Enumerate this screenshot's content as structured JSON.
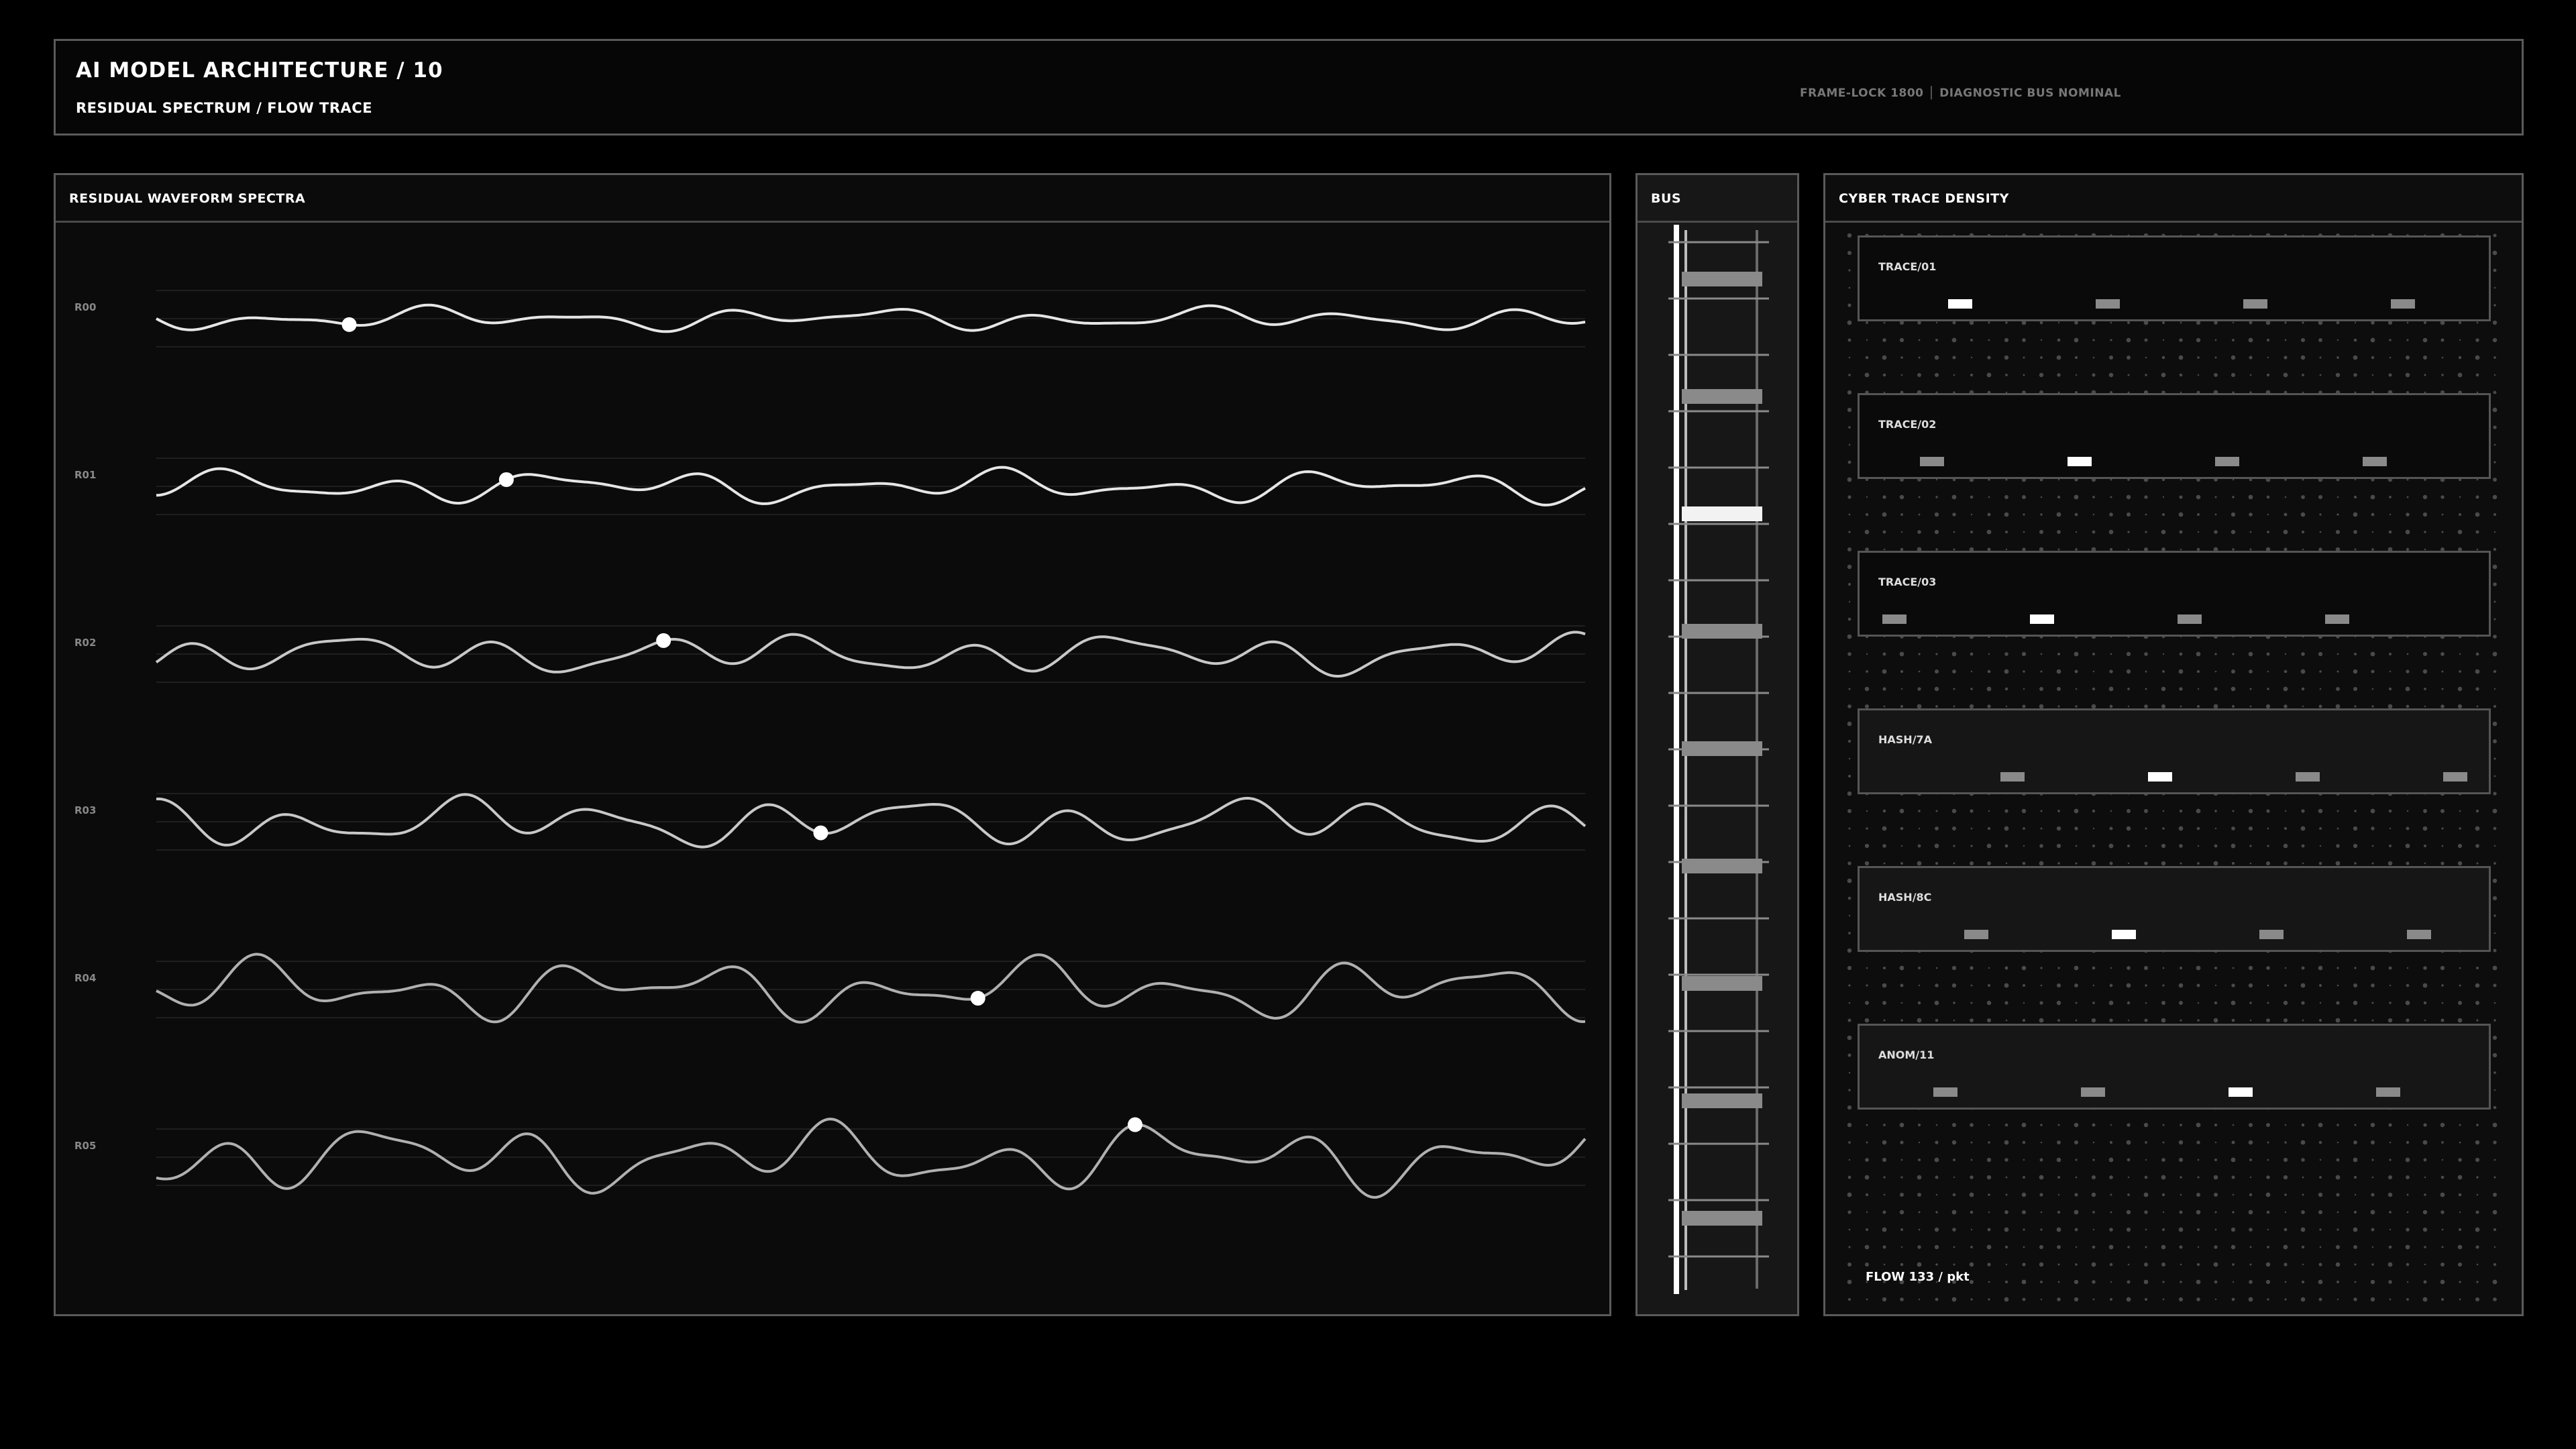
{
  "header": {
    "title": "AI MODEL ARCHITECTURE / 10",
    "subtitle": "RESIDUAL SPECTRUM / FLOW TRACE",
    "status": "FRAME-LOCK 1800 │ DIAGNOSTIC BUS NOMINAL"
  },
  "waveform": {
    "title": "RESIDUAL WAVEFORM SPECTRA",
    "rows": [
      {
        "label": "R00",
        "marker": 0.135
      },
      {
        "label": "R01",
        "marker": 0.245
      },
      {
        "label": "R02",
        "marker": 0.355
      },
      {
        "label": "R03",
        "marker": 0.465
      },
      {
        "label": "R04",
        "marker": 0.575
      },
      {
        "label": "R05",
        "marker": 0.685
      }
    ]
  },
  "bus": {
    "title": "BUS"
  },
  "trace": {
    "title": "CYBER TRACE DENSITY",
    "cards": [
      {
        "label": "TRACE/01",
        "hot": 0
      },
      {
        "label": "TRACE/02",
        "hot": 1
      },
      {
        "label": "TRACE/03",
        "hot": 1
      },
      {
        "label": "HASH/7A",
        "hot": 1
      },
      {
        "label": "HASH/8C",
        "hot": 1
      },
      {
        "label": "ANOM/11",
        "hot": 2
      }
    ],
    "flow": "FLOW 133 / pkt"
  },
  "colors": {
    "accent": "#ffffff",
    "frame": "#5a5a5a",
    "muted": "#8a8a8a"
  }
}
